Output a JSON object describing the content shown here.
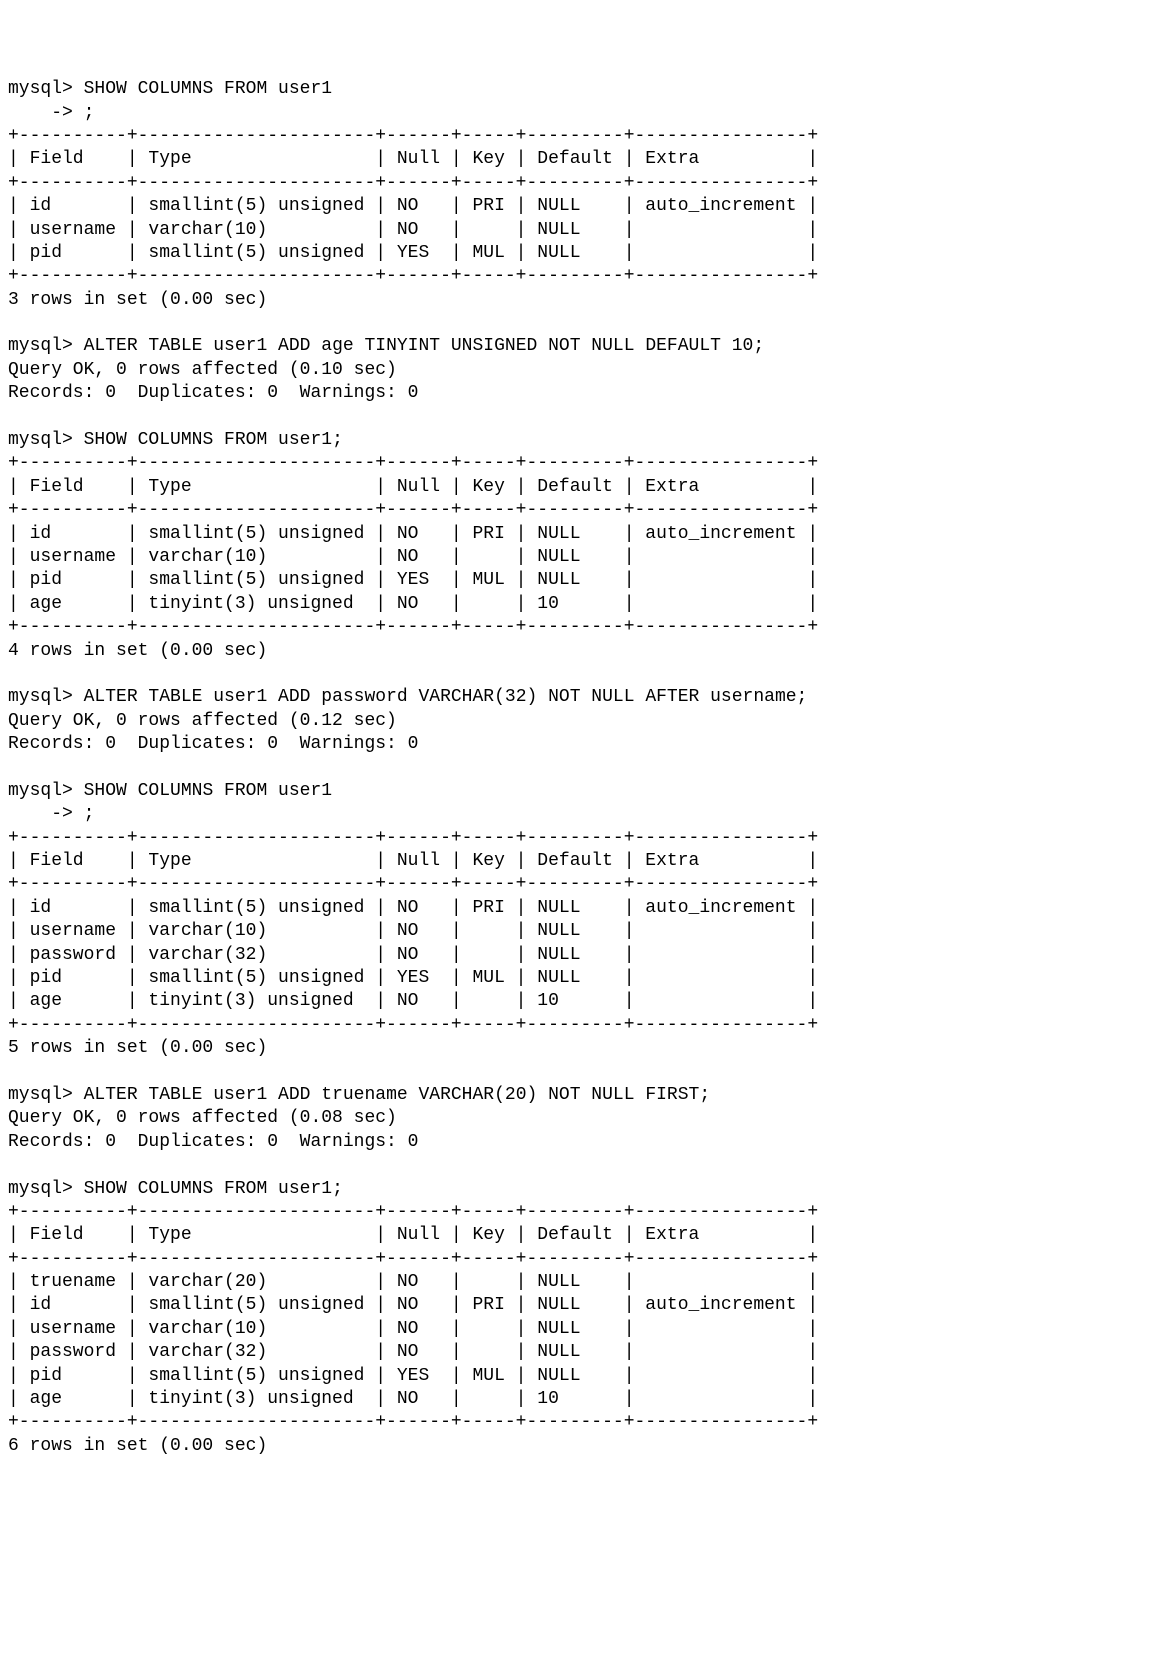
{
  "prompt": "mysql> ",
  "cont": "    -> ",
  "cmds": {
    "show1": "SHOW COLUMNS FROM user1",
    "semi": ";",
    "alter_age": "ALTER TABLE user1 ADD age TINYINT UNSIGNED NOT NULL DEFAULT 10;",
    "ok_010": "Query OK, 0 rows affected (0.10 sec)",
    "records0": "Records: 0  Duplicates: 0  Warnings: 0",
    "show2": "SHOW COLUMNS FROM user1;",
    "alter_pw": "ALTER TABLE user1 ADD password VARCHAR(32) NOT NULL AFTER username;",
    "ok_012": "Query OK, 0 rows affected (0.12 sec)",
    "alter_tn": "ALTER TABLE user1 ADD truename VARCHAR(20) NOT NULL FIRST;",
    "ok_008": "Query OK, 0 rows affected (0.08 sec)"
  },
  "border": "+----------+----------------------+------+-----+---------+----------------+",
  "header": "| Field    | Type                 | Null | Key | Default | Extra          |",
  "t1": {
    "r0": "| id       | smallint(5) unsigned | NO   | PRI | NULL    | auto_increment |",
    "r1": "| username | varchar(10)          | NO   |     | NULL    |                |",
    "r2": "| pid      | smallint(5) unsigned | YES  | MUL | NULL    |                |",
    "summary": "3 rows in set (0.00 sec)"
  },
  "t2": {
    "r0": "| id       | smallint(5) unsigned | NO   | PRI | NULL    | auto_increment |",
    "r1": "| username | varchar(10)          | NO   |     | NULL    |                |",
    "r2": "| pid      | smallint(5) unsigned | YES  | MUL | NULL    |                |",
    "r3": "| age      | tinyint(3) unsigned  | NO   |     | 10      |                |",
    "summary": "4 rows in set (0.00 sec)"
  },
  "t3": {
    "r0": "| id       | smallint(5) unsigned | NO   | PRI | NULL    | auto_increment |",
    "r1": "| username | varchar(10)          | NO   |     | NULL    |                |",
    "r2": "| password | varchar(32)          | NO   |     | NULL    |                |",
    "r3": "| pid      | smallint(5) unsigned | YES  | MUL | NULL    |                |",
    "r4": "| age      | tinyint(3) unsigned  | NO   |     | 10      |                |",
    "summary": "5 rows in set (0.00 sec)"
  },
  "t4": {
    "r0": "| truename | varchar(20)          | NO   |     | NULL    |                |",
    "r1": "| id       | smallint(5) unsigned | NO   | PRI | NULL    | auto_increment |",
    "r2": "| username | varchar(10)          | NO   |     | NULL    |                |",
    "r3": "| password | varchar(32)          | NO   |     | NULL    |                |",
    "r4": "| pid      | smallint(5) unsigned | YES  | MUL | NULL    |                |",
    "r5": "| age      | tinyint(3) unsigned  | NO   |     | 10      |                |",
    "summary": "6 rows in set (0.00 sec)"
  }
}
